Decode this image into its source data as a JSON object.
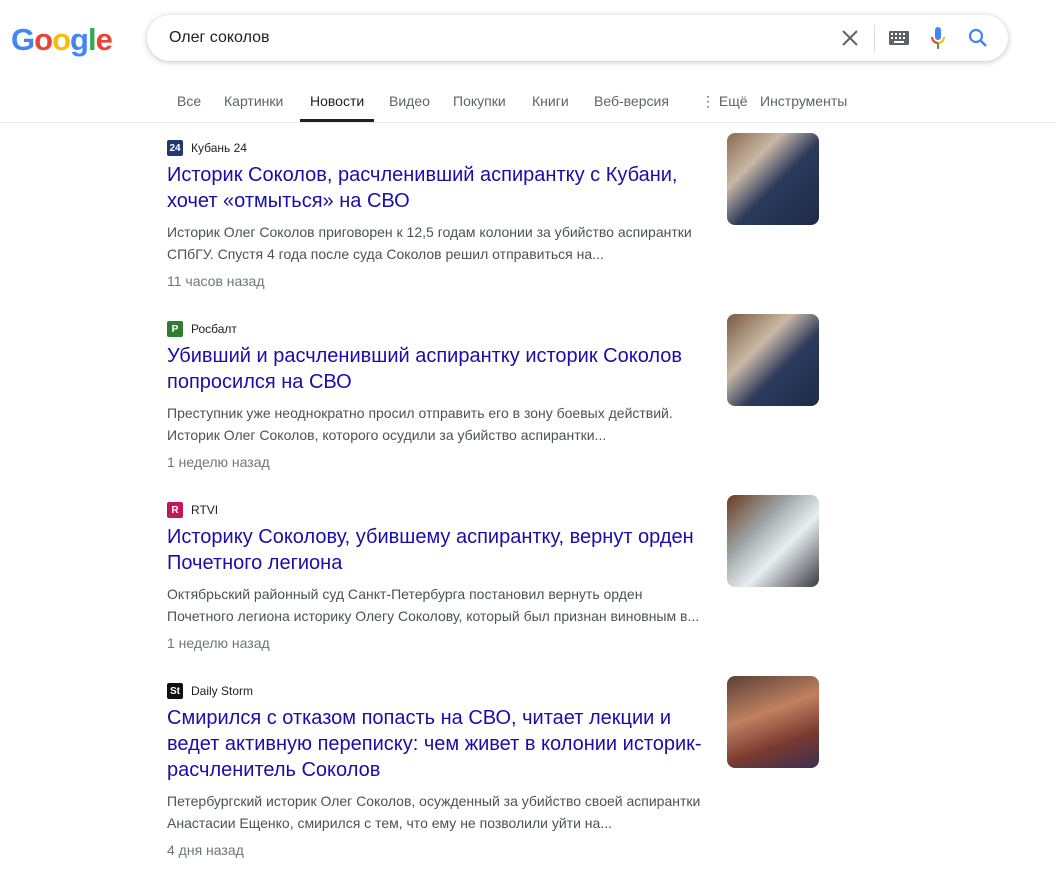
{
  "logo": "Google",
  "search": {
    "query": "Олег соколов"
  },
  "tabs": [
    "Все",
    "Картинки",
    "Новости",
    "Видео",
    "Покупки",
    "Книги",
    "Веб-версия",
    "⋮ Ещё",
    "Инструменты"
  ],
  "results": [
    {
      "source": "Кубань 24",
      "fav": "24",
      "fav_color": "#1e3a6e",
      "title": "Историк Соколов, расчленивший аспирантку с Кубани, хочет «отмыться» на СВО",
      "snippet": "Историк Олег Соколов приговорен к 12,5 годам колонии за убийство аспирантки СПбГУ. Спустя 4 года после суда Соколов решил отправиться на...",
      "time": "11 часов назад"
    },
    {
      "source": "Росбалт",
      "fav": "P",
      "fav_color": "#2e7d32",
      "title": "Убивший и расчленивший аспирантку историк Соколов попросился на СВО",
      "snippet": "Преступник уже неоднократно просил отправить его в зону боевых действий. Историк Олег Соколов, которого осудили за убийство аспирантки...",
      "time": "1 неделю назад"
    },
    {
      "source": "RTVI",
      "fav": "R",
      "fav_color": "#c2185b",
      "title": "Историку Соколову, убившему аспирантку, вернут орден Почетного легиона",
      "snippet": "Октябрьский районный суд Санкт-Петербурга постановил вернуть орден Почетного легиона историку Олегу Соколову, который был признан виновным в...",
      "time": "1 неделю назад"
    },
    {
      "source": "Daily Storm",
      "fav": "St",
      "fav_color": "#111111",
      "title": "Смирился с отказом попасть на СВО, читает лекции и ведет активную переписку: чем живет в колонии историк-расчленитель Соколов",
      "snippet": "Петербургский историк Олег Соколов, осужденный за убийство своей аспирантки Анастасии Ещенко, смирился с тем, что ему не позволили уйти на...",
      "time": "4 дня назад"
    }
  ]
}
